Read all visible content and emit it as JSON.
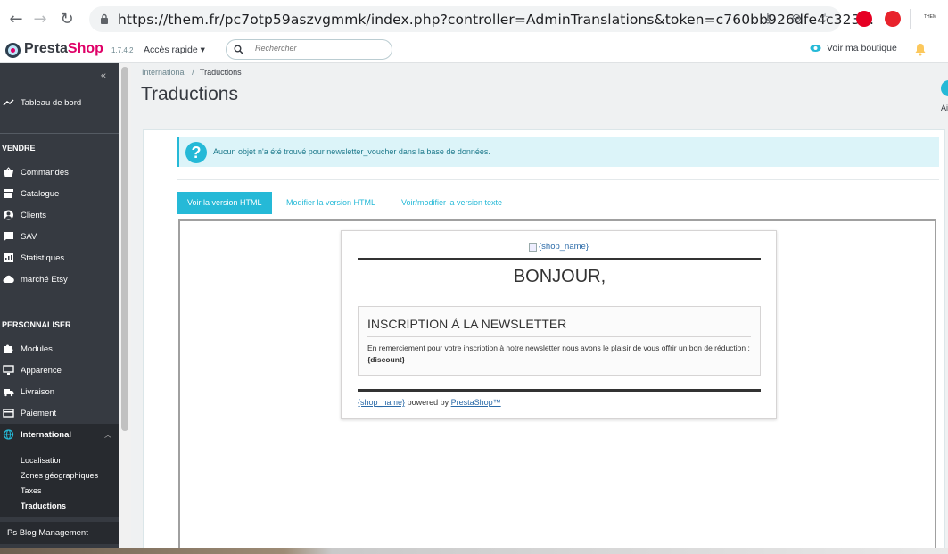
{
  "browser": {
    "url": "https://them.fr/pc7otp59aszvgmmk/index.php?controller=AdminTranslations&token=c760bb926dfe4c323…",
    "profile_label": "THEM"
  },
  "header": {
    "logo_part1": "Presta",
    "logo_part2": "Shop",
    "version": "1.7.4.2",
    "quick_access": "Accès rapide ▾",
    "search_placeholder": "Rechercher",
    "view_shop": "Voir ma boutique"
  },
  "sidebar": {
    "dashboard": "Tableau de bord",
    "section_sell": "VENDRE",
    "sell_items": [
      "Commandes",
      "Catalogue",
      "Clients",
      "SAV",
      "Statistiques",
      "marché Etsy"
    ],
    "section_customize": "PERSONNALISER",
    "customize_items": [
      "Modules",
      "Apparence",
      "Livraison",
      "Paiement",
      "International"
    ],
    "sub_items": [
      "Localisation",
      "Zones géographiques",
      "Taxes",
      "Traductions"
    ],
    "blog": "Ps Blog Management"
  },
  "breadcrumb": {
    "parent": "International",
    "sep": "/",
    "current": "Traductions"
  },
  "page_title": "Traductions",
  "help_label": "Ai",
  "alert": {
    "icon": "?",
    "text": "Aucun objet n'a été trouvé pour newsletter_voucher dans la base de données."
  },
  "tabs": [
    "Voir la version HTML",
    "Modifier la version HTML",
    "Voir/modifier la version texte"
  ],
  "email": {
    "logo_alt": "{shop_name}",
    "greeting": "BONJOUR,",
    "box_title": "INSCRIPTION À LA NEWSLETTER",
    "box_text": "En remerciement pour votre inscription à notre newsletter nous avons le plaisir de vous offrir un bon de réduction :",
    "box_code": "{discount}",
    "footer_shop": "{shop_name}",
    "footer_mid": "powered by",
    "footer_brand": "PrestaShop™"
  },
  "colors": {
    "accent": "#25b9d7",
    "sidebar": "#363a41",
    "brand_pink": "#df0067"
  }
}
